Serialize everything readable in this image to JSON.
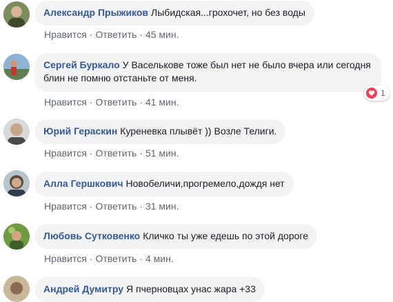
{
  "comments": [
    {
      "author": "Александр Прыжиков",
      "text": "Лыбидская...грохочет, но без воды",
      "like_label": "Нравится",
      "reply_label": "Ответить",
      "time": "45 мин."
    },
    {
      "author": "Сергей Буркало",
      "text": "У Васелькове тоже был нет не было вчера или сегодня блин не помню отстаньте от меня.",
      "like_label": "Нравится",
      "reply_label": "Ответить",
      "time": "41 мин.",
      "reaction": {
        "type": "love",
        "count": "1",
        "color": "#f33e58"
      }
    },
    {
      "author": "Юрий Гераскин",
      "text": "Куреневка плывёт )) Возле Телиги.",
      "like_label": "Нравится",
      "reply_label": "Ответить",
      "time": "51 мин."
    },
    {
      "author": "Алла Гершкович",
      "text": "Новобеличи,прогремело,дождя нет",
      "like_label": "Нравится",
      "reply_label": "Ответить",
      "time": "31 мин."
    },
    {
      "author": "Любовь Сутковенко",
      "text": "Кличко ты уже едешь по этой дороге",
      "like_label": "Нравится",
      "reply_label": "Ответить",
      "time": "4 мин."
    },
    {
      "author": "Андрей Думитру",
      "text": "Я пчерновцах унас жара +33"
    }
  ],
  "colors": {
    "author": "#385898",
    "bubble": "#f2f3f5",
    "meta": "#606770"
  },
  "icons": {
    "reaction": "heart-icon",
    "separator": "middle-dot"
  },
  "separator": "·"
}
